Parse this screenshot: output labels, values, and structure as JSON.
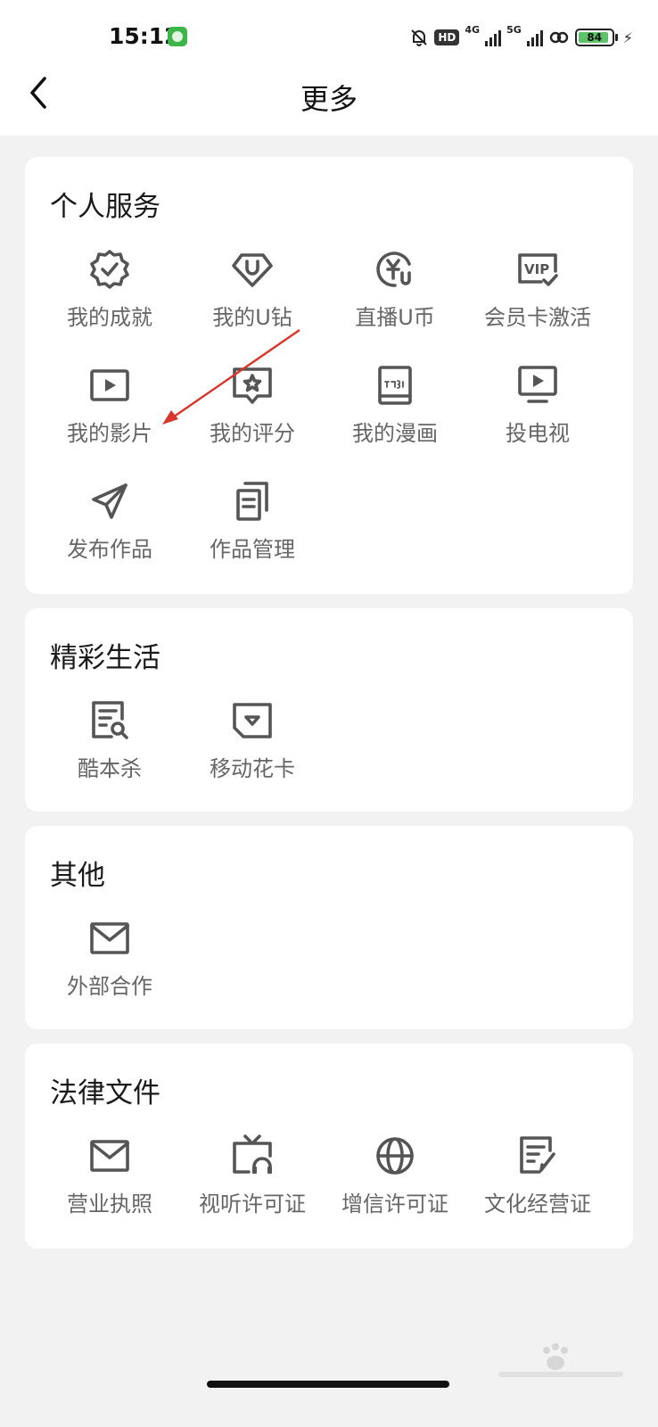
{
  "status_bar": {
    "time": "15:12",
    "hd": "HD",
    "net_4g": "4G",
    "net_5g": "5G",
    "battery": "84"
  },
  "header": {
    "title": "更多",
    "back_icon": "chevron-left-icon"
  },
  "sections": [
    {
      "title": "个人服务",
      "items": [
        {
          "label": "我的成就",
          "icon": "achievement-badge-icon"
        },
        {
          "label": "我的U钻",
          "icon": "u-diamond-icon"
        },
        {
          "label": "直播U币",
          "icon": "u-coin-icon"
        },
        {
          "label": "会员卡激活",
          "icon": "vip-card-icon"
        },
        {
          "label": "我的影片",
          "icon": "video-play-icon"
        },
        {
          "label": "我的评分",
          "icon": "rating-star-icon"
        },
        {
          "label": "我的漫画",
          "icon": "comic-book-icon"
        },
        {
          "label": "投电视",
          "icon": "cast-tv-icon"
        },
        {
          "label": "发布作品",
          "icon": "paper-plane-icon"
        },
        {
          "label": "作品管理",
          "icon": "works-manage-icon"
        }
      ]
    },
    {
      "title": "精彩生活",
      "items": [
        {
          "label": "酷本杀",
          "icon": "script-search-icon"
        },
        {
          "label": "移动花卡",
          "icon": "flower-card-icon"
        }
      ]
    },
    {
      "title": "其他",
      "items": [
        {
          "label": "外部合作",
          "icon": "envelope-icon"
        }
      ]
    },
    {
      "title": "法律文件",
      "items": [
        {
          "label": "营业执照",
          "icon": "envelope-icon"
        },
        {
          "label": "视听许可证",
          "icon": "tv-headphones-icon"
        },
        {
          "label": "增信许可证",
          "icon": "globe-icon"
        },
        {
          "label": "文化经营证",
          "icon": "document-edit-icon"
        }
      ]
    }
  ],
  "colors": {
    "background": "#f2f2f2",
    "card": "#ffffff",
    "icon": "#555555",
    "label": "#666666",
    "annotation_arrow": "#d9362b"
  }
}
